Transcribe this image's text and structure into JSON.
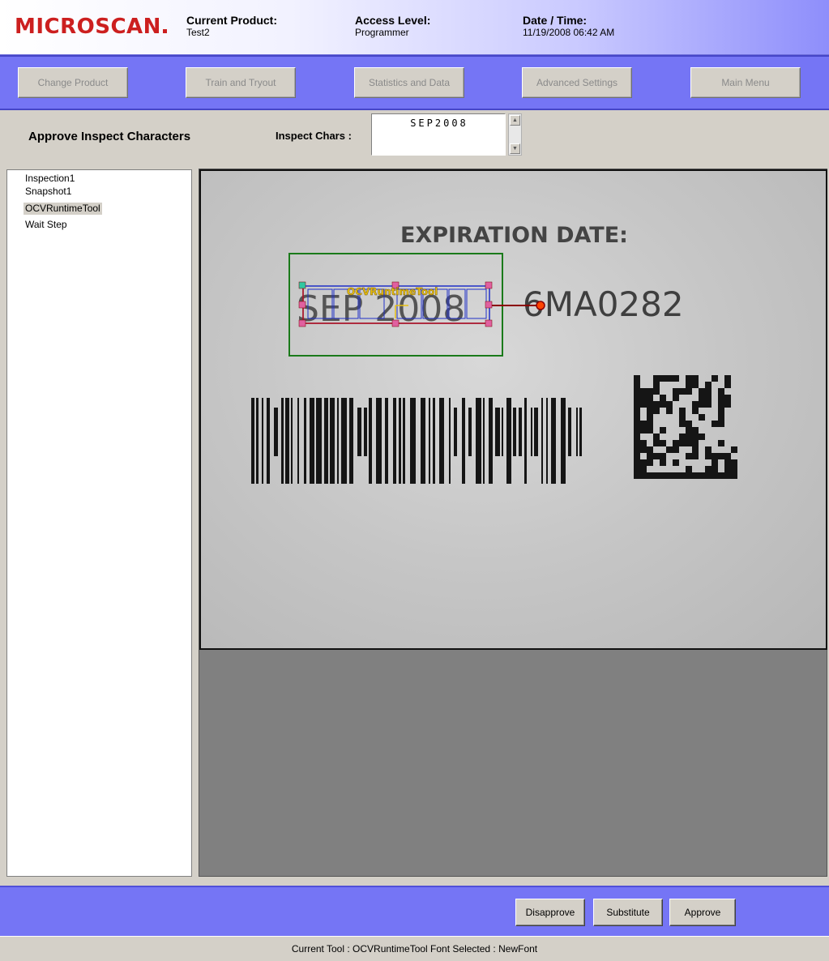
{
  "header": {
    "logo": "MICROSCAN",
    "current_product_label": "Current Product:",
    "current_product_value": "Test2",
    "access_level_label": "Access Level:",
    "access_level_value": "Programmer",
    "datetime_label": "Date / Time:",
    "datetime_value": "11/19/2008 06:42 AM"
  },
  "nav": {
    "change_product": "Change Product",
    "train_tryout": "Train and Tryout",
    "statistics_data": "Statistics and Data",
    "advanced_settings": "Advanced Settings",
    "main_menu": "Main Menu"
  },
  "title": {
    "page_title": "Approve Inspect Characters",
    "inspect_label": "Inspect Chars :",
    "inspect_value": "SEP2008"
  },
  "tree": {
    "items": [
      {
        "label": "Inspection1"
      },
      {
        "label": "Snapshot1"
      },
      {
        "label": "OCVRuntimeTool"
      },
      {
        "label": "Wait Step"
      }
    ]
  },
  "image": {
    "heading": "EXPIRATION DATE:",
    "ocv_text": "SEP 2008",
    "lot_code": "6MA0282",
    "tool_label": "OCVRuntimeTool"
  },
  "actions": {
    "disapprove": "Disapprove",
    "substitute": "Substitute",
    "approve": "Approve"
  },
  "status": {
    "text": "Current Tool :  OCVRuntimeTool     Font Selected : NewFont"
  },
  "colors": {
    "logo": "#cc1f1f",
    "band": "#7575f5",
    "roi_green": "#1a7a1a",
    "roi_blue": "#2030c8",
    "roi_red": "#c01010",
    "tool_label": "#e8c010"
  }
}
